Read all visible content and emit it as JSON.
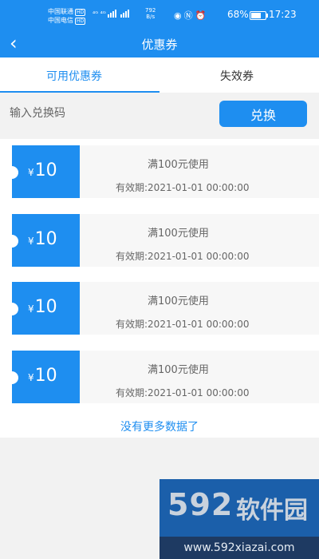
{
  "status_bar": {
    "carrier1": "中国联通",
    "carrier2": "中国电信",
    "hd_badge": "HD",
    "signal_label": "⁴ᴳ ⁴ᴳ",
    "net_speed": "792",
    "net_unit": "B/s",
    "battery_pct": "68%",
    "battery_level": 68,
    "time": "17:23"
  },
  "header": {
    "title": "优惠券"
  },
  "tabs": [
    {
      "label": "可用优惠券"
    },
    {
      "label": "失效券"
    }
  ],
  "redeem": {
    "placeholder": "输入兑换码",
    "button_label": "兑换"
  },
  "coupons": [
    {
      "currency": "¥",
      "amount": "10",
      "condition": "满100元使用",
      "validity": "有效期:2021-01-01 00:00:00"
    },
    {
      "currency": "¥",
      "amount": "10",
      "condition": "满100元使用",
      "validity": "有效期:2021-01-01 00:00:00"
    },
    {
      "currency": "¥",
      "amount": "10",
      "condition": "满100元使用",
      "validity": "有效期:2021-01-01 00:00:00"
    },
    {
      "currency": "¥",
      "amount": "10",
      "condition": "满100元使用",
      "validity": "有效期:2021-01-01 00:00:00"
    }
  ],
  "list_footer": "没有更多数据了",
  "watermark": {
    "number": "592",
    "brand": "软件园",
    "url": "www.592xiazai.com"
  },
  "colors": {
    "primary": "#1e8ef0"
  }
}
